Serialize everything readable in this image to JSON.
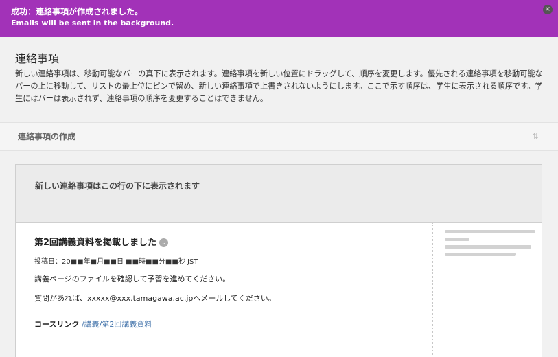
{
  "banner": {
    "line1": "成功：連絡事項が作成されました。",
    "line2": "Emails will be sent in the background.",
    "close_glyph": "×"
  },
  "page": {
    "title": "連絡事項",
    "description": "新しい連絡事項は、移動可能なバーの真下に表示されます。連絡事項を新しい位置にドラッグして、順序を変更します。優先される連絡事項を移動可能なバーの上に移動して、リストの最上位にピンで留め、新しい連絡事項で上書きされないようにします。ここで示す順序は、学生に表示される順序です。学生にはバーは表示されず、連絡事項の順序を変更することはできません。"
  },
  "create_bar": {
    "label": "連絡事項の作成",
    "sort_glyph": "⇅"
  },
  "divider": {
    "label": "新しい連絡事項はこの行の下に表示されます"
  },
  "announcement": {
    "title": "第2回講義資料を掲載しました",
    "chevron_glyph": "⌄",
    "posted": "投稿日：20■■年■月■■日 ■■時■■分■■秒 JST",
    "body1": "講義ページのファイルを確認して予習を進めてください。",
    "body2": "質問があれば、xxxxx@xxx.tamagawa.ac.jpへメールしてください。",
    "course_link_label": "コースリンク",
    "course_link_path": "/講義/第2回講義資料"
  },
  "icons": {
    "close": "close-icon",
    "sort": "sort-arrows-icon",
    "chevron": "chevron-down-icon"
  },
  "colors": {
    "banner_bg": "#a232b8",
    "link": "#3d6fa8"
  }
}
